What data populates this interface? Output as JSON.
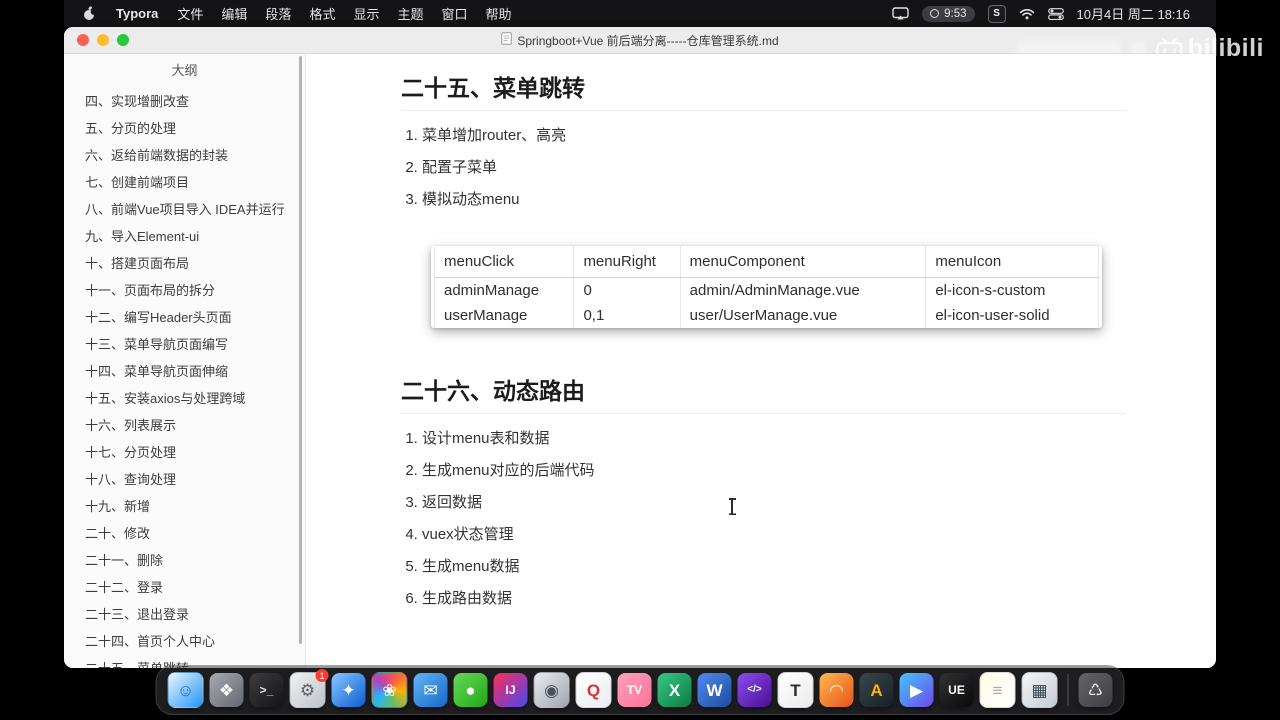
{
  "menubar": {
    "app_name": "Typora",
    "menus": [
      "文件",
      "编辑",
      "段落",
      "格式",
      "显示",
      "主题",
      "窗口",
      "帮助"
    ],
    "record_time": "9:53",
    "sogou_label": "S",
    "datetime": "10月4日 周二 18:16"
  },
  "window": {
    "title": "Springboot+Vue 前后端分离-----仓库管理系统.md"
  },
  "sidebar": {
    "title": "大纲",
    "items": [
      "四、实现增删改查",
      "五、分页的处理",
      "六、返给前端数据的封装",
      "七、创建前端项目",
      "八、前端Vue项目导入 IDEA并运行",
      "九、导入Element-ui",
      "十、搭建页面布局",
      "十一、页面布局的拆分",
      "十二、编写Header头页面",
      "十三、菜单导航页面编写",
      "十四、菜单导航页面伸缩",
      "十五、安装axios与处理跨域",
      "十六、列表展示",
      "十七、分页处理",
      "十八、查询处理",
      "十九、新增",
      "二十、修改",
      "二十一、删除",
      "二十二、登录",
      "二十三、退出登录",
      "二十四、首页个人中心",
      "二十五、菜单跳转"
    ]
  },
  "content": {
    "section1": {
      "heading": "二十五、菜单跳转",
      "list": [
        "菜单增加router、高亮",
        "配置子菜单",
        "模拟动态menu"
      ],
      "table": {
        "headers": [
          "menuClick",
          "menuRight",
          "menuComponent",
          "menuIcon"
        ],
        "rows": [
          [
            "adminManage",
            "0",
            "admin/AdminManage.vue",
            "el-icon-s-custom"
          ],
          [
            "userManage",
            "0,1",
            "user/UserManage.vue",
            "el-icon-user-solid"
          ]
        ]
      }
    },
    "section2": {
      "heading": "二十六、动态路由",
      "list": [
        "设计menu表和数据",
        "生成menu对应的后端代码",
        "返回数据",
        "vuex状态管理",
        "生成menu数据",
        "生成路由数据"
      ]
    }
  },
  "watermark": {
    "logo_text": "bilibili"
  },
  "dock": {
    "items": [
      {
        "name": "finder",
        "glyph": "☺",
        "c1": "#eef7ff",
        "c2": "#2196f3",
        "fg": "#1867c0",
        "light": true
      },
      {
        "name": "launchpad",
        "glyph": "❖",
        "c1": "#a6abb2",
        "c2": "#63676d",
        "fg": "#ffffff"
      },
      {
        "name": "terminal",
        "glyph": ">_",
        "c1": "#3d3d40",
        "c2": "#141416",
        "fg": "#e8e8e8"
      },
      {
        "name": "system-preferences",
        "glyph": "⚙",
        "c1": "#f2f2f4",
        "c2": "#bec3ca",
        "fg": "#5d6269",
        "light": true,
        "badge": "1"
      },
      {
        "name": "safari",
        "glyph": "✦",
        "c1": "#86c9ff",
        "c2": "#0d5bd4",
        "fg": "#ffffff"
      },
      {
        "name": "photos",
        "glyph": "❀",
        "c1": "conic",
        "c2": "",
        "fg": "#ffffff",
        "light": true
      },
      {
        "name": "mail",
        "glyph": "✉",
        "c1": "#63b4f6",
        "c2": "#1668c6",
        "fg": "#ffffff"
      },
      {
        "name": "wechat",
        "glyph": "●",
        "c1": "#66d957",
        "c2": "#22a718",
        "fg": "#ffffff"
      },
      {
        "name": "intellij-idea",
        "glyph": "IJ",
        "c1": "#fe2c57",
        "c2": "#4a48f1",
        "fg": "#ffffff"
      },
      {
        "name": "screen-capture",
        "glyph": "◉",
        "c1": "#e9ebee",
        "c2": "#a0a7af",
        "fg": "#4b5157",
        "light": true
      },
      {
        "name": "qq",
        "glyph": "Q",
        "c1": "#ffffff",
        "c2": "#e9edf1",
        "fg": "#e03131",
        "light": true
      },
      {
        "name": "bilibili",
        "glyph": "TV",
        "c1": "#ff9fbc",
        "c2": "#fb7299",
        "fg": "#ffffff"
      },
      {
        "name": "excel",
        "glyph": "X",
        "c1": "#35c885",
        "c2": "#0e7a41",
        "fg": "#ffffff"
      },
      {
        "name": "word",
        "glyph": "W",
        "c1": "#5089f2",
        "c2": "#1c4e9f",
        "fg": "#ffffff"
      },
      {
        "name": "code-editor",
        "glyph": "</>",
        "c1": "#8d4cf3",
        "c2": "#470f8e",
        "fg": "#ffffff"
      },
      {
        "name": "typora",
        "glyph": "T",
        "c1": "#ffffff",
        "c2": "#ebebeb",
        "fg": "#2d2d2d",
        "light": true
      },
      {
        "name": "browser",
        "glyph": "◠",
        "c1": "#ffb84d",
        "c2": "#e5541c",
        "fg": "#fff4e0"
      },
      {
        "name": "design-tool",
        "glyph": "A",
        "c1": "#3b474e",
        "c2": "#161f24",
        "fg": "#ffb300"
      },
      {
        "name": "media-player",
        "glyph": "▶",
        "c1": "#43c6ff",
        "c2": "#7048e8",
        "fg": "#ffffff"
      },
      {
        "name": "unreal-editor",
        "glyph": "UE",
        "c1": "#323234",
        "c2": "#09090a",
        "fg": "#ffffff"
      },
      {
        "name": "notes",
        "glyph": "≡",
        "c1": "#fffbe6",
        "c2": "#ffffff",
        "fg": "#a8a8a8",
        "light": true
      },
      {
        "name": "display-monitor",
        "glyph": "▦",
        "c1": "#f6f7f8",
        "c2": "#c3ccd3",
        "fg": "#36454f",
        "light": true
      },
      {
        "name": "trash",
        "glyph": "♺",
        "c1": "rgba(250,250,252,0.32)",
        "c2": "rgba(170,174,182,0.22)",
        "fg": "#ececec",
        "divider_before": true
      }
    ]
  },
  "colors": {
    "bilibili_pink": "#fb7299",
    "menubar_bg": "#151517",
    "titlebar_bg": "#ececec"
  }
}
